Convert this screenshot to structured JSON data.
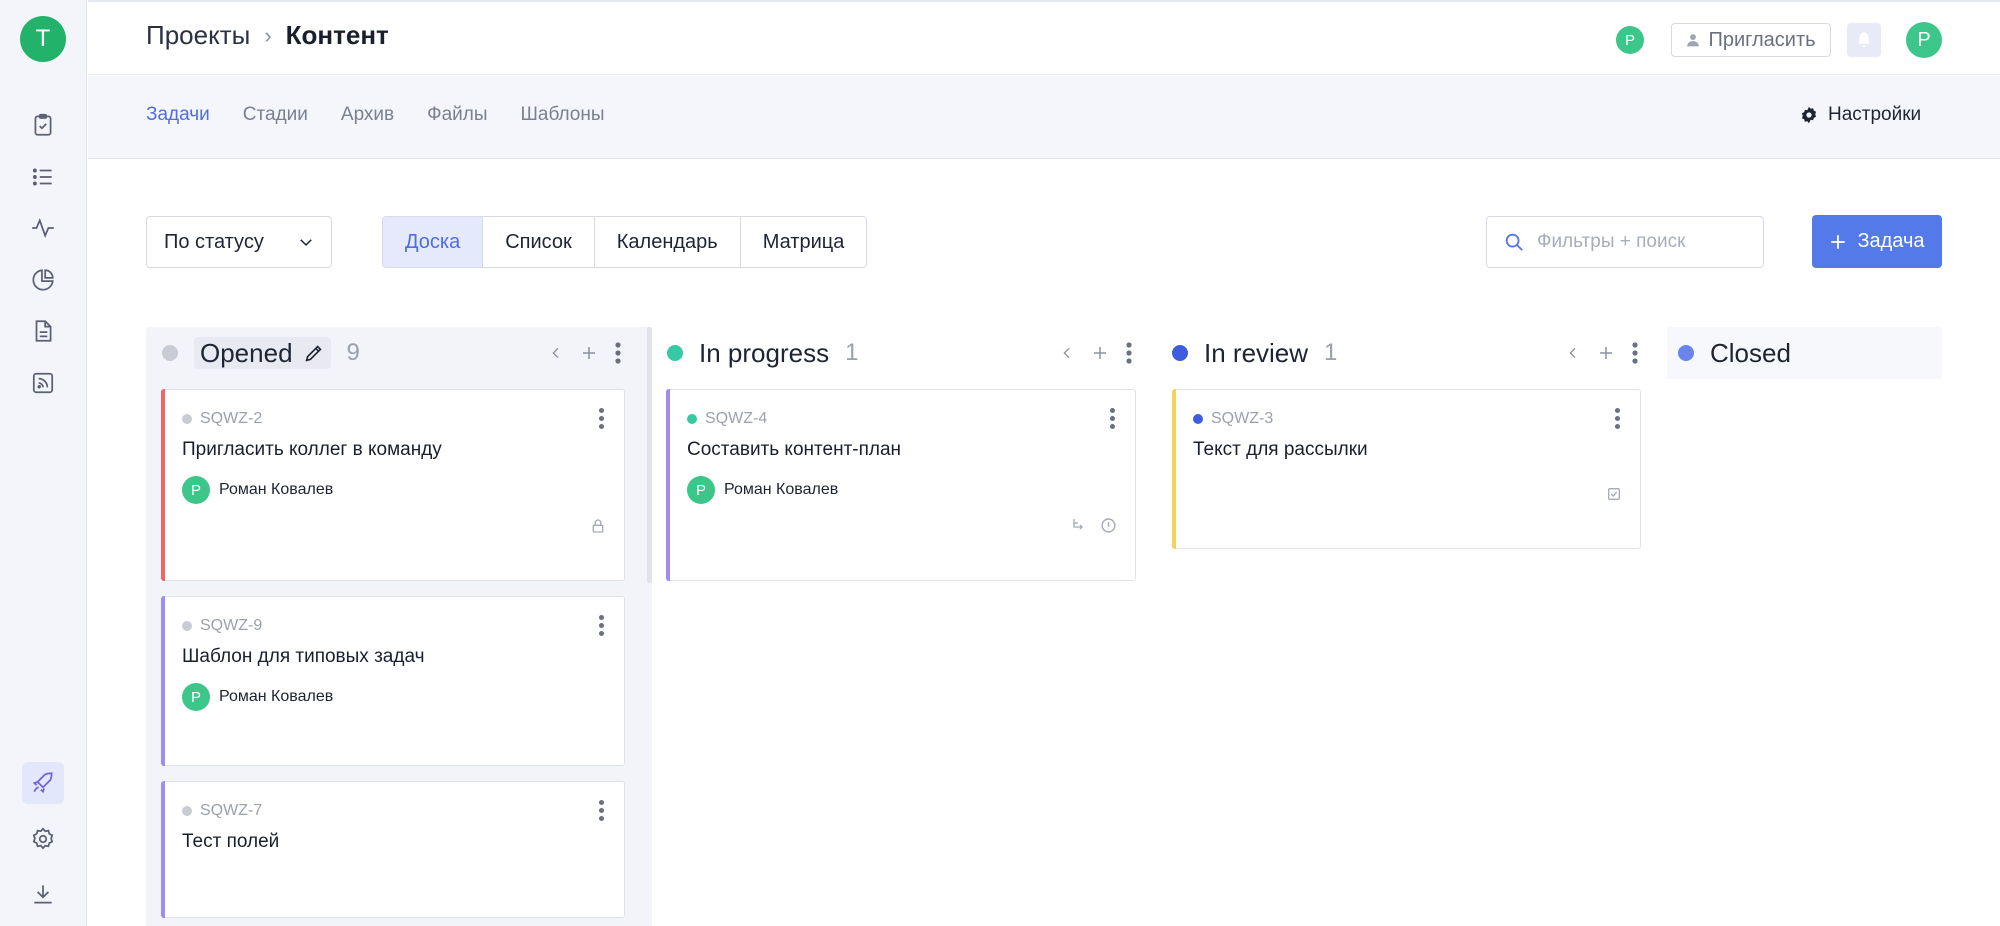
{
  "workspace": {
    "avatar_letter": "T"
  },
  "sidebar": {
    "icons": [
      "tasks-icon",
      "list-icon",
      "activity-icon",
      "reports-icon",
      "document-icon",
      "feed-icon",
      "rocket-icon",
      "settings-icon",
      "download-icon"
    ],
    "active": "rocket-icon"
  },
  "header": {
    "breadcrumb_parent": "Проекты",
    "breadcrumb_separator": "›",
    "breadcrumb_current": "Контент",
    "mini_avatar_letter": "Р",
    "invite_label": "Пригласить",
    "user_avatar_letter": "Р"
  },
  "subnav": {
    "tabs": [
      {
        "label": "Задачи",
        "active": true
      },
      {
        "label": "Стадии",
        "active": false
      },
      {
        "label": "Архив",
        "active": false
      },
      {
        "label": "Файлы",
        "active": false
      },
      {
        "label": "Шаблоны",
        "active": false
      }
    ],
    "settings_label": "Настройки"
  },
  "toolbar": {
    "group_by": "По статусу",
    "views": [
      {
        "label": "Доска",
        "active": true
      },
      {
        "label": "Список",
        "active": false
      },
      {
        "label": "Календарь",
        "active": false
      },
      {
        "label": "Матрица",
        "active": false
      }
    ],
    "search_placeholder": "Фильтры + поиск",
    "add_task_label": "Задача"
  },
  "colors": {
    "accent": "#5479e8",
    "opened": "#c9ccd5",
    "in_progress": "#36c9a3",
    "in_review": "#3d5ce0",
    "closed": "#6b84ec",
    "accent_red": "#f06565",
    "accent_purple": "#a08bf0",
    "accent_yellow": "#f3d35a"
  },
  "board": {
    "columns": [
      {
        "title": "Opened",
        "count": "9",
        "cards": [
          {
            "id": "SQWZ-2",
            "title": "Пригласить коллег в команду",
            "assignee": "Роман Ковалев",
            "avatar": "Р",
            "icons": [
              "lock-icon"
            ]
          },
          {
            "id": "SQWZ-9",
            "title": "Шаблон для типовых задач",
            "assignee": "Роман Ковалев",
            "avatar": "Р",
            "icons": []
          },
          {
            "id": "SQWZ-7",
            "title": "Тест полей",
            "assignee": "",
            "avatar": "",
            "icons": []
          }
        ]
      },
      {
        "title": "In progress",
        "count": "1",
        "cards": [
          {
            "id": "SQWZ-4",
            "title": "Составить контент-план",
            "assignee": "Роман Ковалев",
            "avatar": "Р",
            "icons": [
              "subtask-icon",
              "info-icon"
            ]
          }
        ]
      },
      {
        "title": "In review",
        "count": "1",
        "cards": [
          {
            "id": "SQWZ-3",
            "title": "Текст для рассылки",
            "assignee": "",
            "avatar": "",
            "icons": [
              "checklist-icon"
            ]
          }
        ]
      },
      {
        "title": "Closed",
        "count": "",
        "cards": []
      }
    ]
  }
}
